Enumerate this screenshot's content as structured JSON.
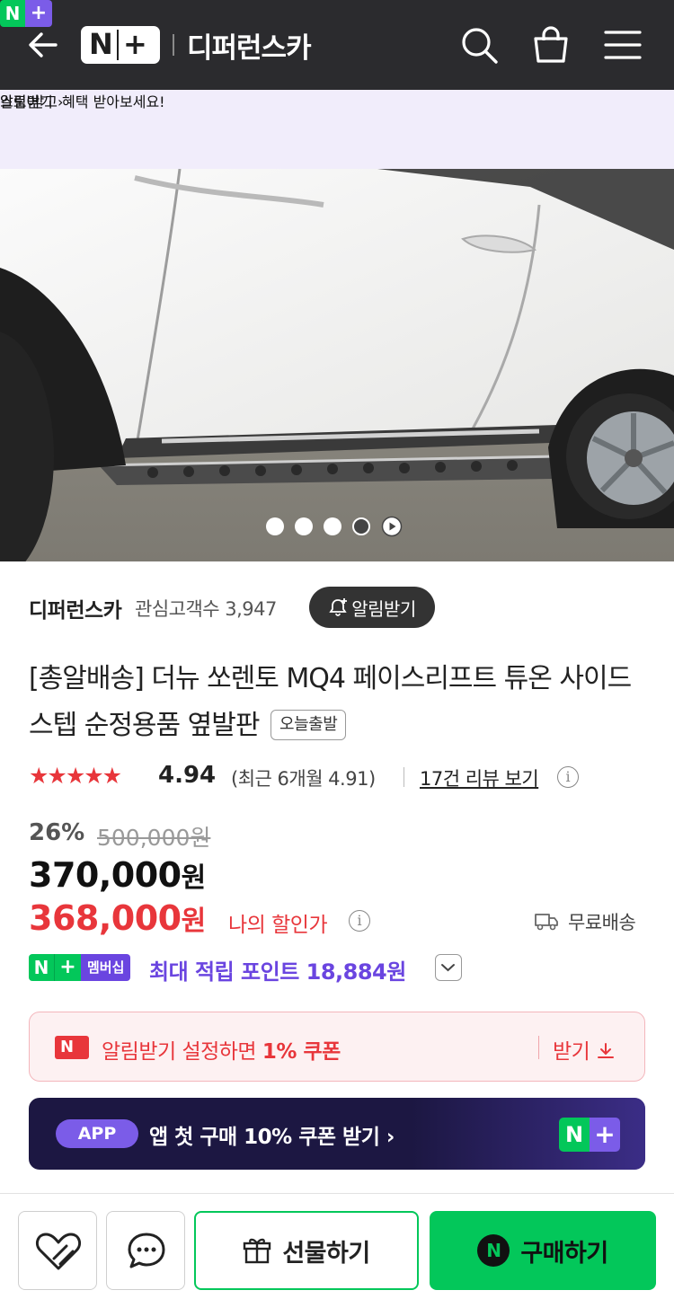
{
  "header": {
    "logo_n": "N",
    "logo_plus": "+",
    "store_name": "디퍼런스카",
    "icons": [
      "back-arrow-icon",
      "search-icon",
      "shopping-bag-icon",
      "menu-icon"
    ]
  },
  "notice": {
    "badge_n": "N",
    "badge_plus": "+",
    "store_label": "스토어",
    "message": "알림 받고 혜택 받아보세요!",
    "action": "알림받기 ›"
  },
  "gallery": {
    "total_slides": 5,
    "active_slide": 4
  },
  "seller": {
    "name": "디퍼런스카",
    "fans_label": "관심고객수 3,947",
    "follow_button": "알림받기"
  },
  "product": {
    "title": "[총알배송] 더뉴 쏘렌토 MQ4 페이스리프트 튜온 사이드스텝 순정용품 옆발판",
    "tag": "오늘출발"
  },
  "rating": {
    "stars": 5,
    "score": "4.94",
    "recent": "(최근 6개월 4.91)",
    "review_link": "17건 리뷰 보기"
  },
  "price": {
    "discount_rate": "26%",
    "original": "500,000원",
    "sale_value": "370,000",
    "sale_unit": "원",
    "my_value": "368,000",
    "my_unit": "원",
    "my_label": "나의 할인가",
    "shipping": "무료배송"
  },
  "points": {
    "badge_n": "N",
    "badge_plus": "+",
    "badge_member": "멤버십",
    "text": "최대 적립 포인트 18,884원"
  },
  "coupon": {
    "badge": "N",
    "text_prefix": "알림받기 설정하면 ",
    "text_bold": "1% 쿠폰",
    "action": "받기"
  },
  "promo": {
    "tag": "APP",
    "text": "앱 첫 구매 10% 쿠폰 받기 ›",
    "logo_n": "N",
    "logo_plus": "+"
  },
  "bottom": {
    "gift_label": "선물하기",
    "buy_label": "구매하기",
    "buy_badge": "N"
  },
  "colors": {
    "naver_green": "#03c75a",
    "brand_purple": "#6a45e0",
    "sale_red": "#e8363b",
    "topbar": "#2b2b2e"
  }
}
